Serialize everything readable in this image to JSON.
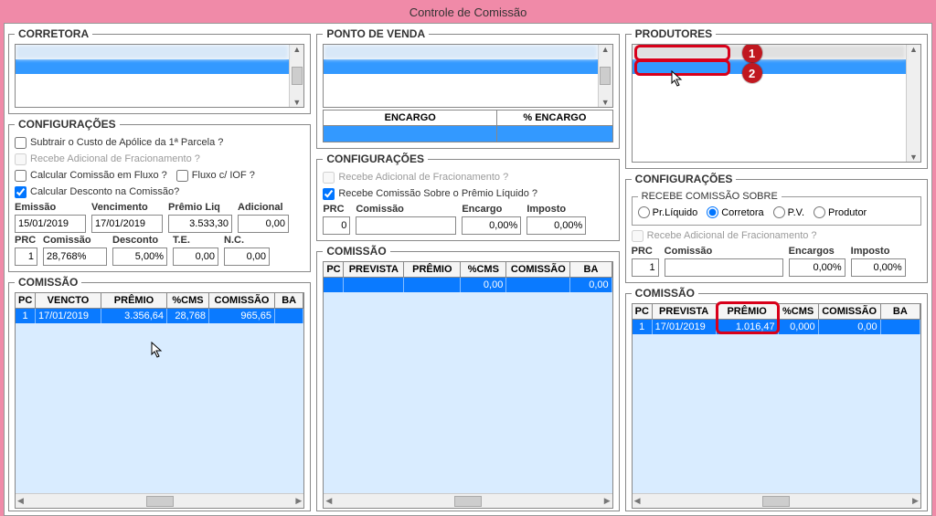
{
  "window_title": "Controle de Comissão",
  "col1": {
    "corretora_title": "CORRETORA",
    "config_title": "CONFIGURAÇÕES",
    "cb_subtrair": "Subtrair o Custo de Apólice da 1ª Parcela ?",
    "cb_recebe_adic": "Recebe Adicional de Fracionamento ?",
    "cb_calc_fluxo": "Calcular Comissão em Fluxo ?",
    "cb_fluxo_iof": "Fluxo c/ IOF ?",
    "cb_calc_desc": "Calcular Desconto na Comissão?",
    "lbl_emissao": "Emissão",
    "lbl_venc": "Vencimento",
    "lbl_premio_liq": "Prêmio Liq",
    "lbl_adicional": "Adicional",
    "val_emissao": "15/01/2019",
    "val_venc": "17/01/2019",
    "val_premio_liq": "3.533,30",
    "val_adicional": "0,00",
    "lbl_prc": "PRC",
    "lbl_comissao": "Comissão",
    "lbl_desconto": "Desconto",
    "lbl_te": "T.E.",
    "lbl_nc": "N.C.",
    "val_prc": "1",
    "val_comissao": "28,768%",
    "val_desconto": "5,00%",
    "val_te": "0,00",
    "val_nc": "0,00",
    "comissao_title": "COMISSÃO",
    "grid": {
      "headers": [
        "PC",
        "VENCTO",
        "PRÊMIO",
        "%CMS",
        "COMISSÃO",
        "BA"
      ],
      "row": [
        "1",
        "17/01/2019",
        "3.356,64",
        "28,768",
        "965,65",
        ""
      ]
    }
  },
  "col2": {
    "pdv_title": "PONTO DE VENDA",
    "lbl_encargo": "ENCARGO",
    "lbl_pct_encargo": "% ENCARGO",
    "config_title": "CONFIGURAÇÕES",
    "cb_recebe_adic": "Recebe Adicional de Fracionamento ?",
    "cb_recebe_com_liq": "Recebe Comissão Sobre o Prêmio Líquido ?",
    "lbl_prc": "PRC",
    "lbl_comissao": "Comissão",
    "lbl_encargo2": "Encargo",
    "lbl_imposto": "Imposto",
    "val_prc": "0",
    "val_comissao": "",
    "val_encargo": "0,00%",
    "val_imposto": "0,00%",
    "comissao_title": "COMISSÃO",
    "grid": {
      "headers": [
        "PC",
        "PREVISTA",
        "PRÊMIO",
        "%CMS",
        "COMISSÃO",
        "BA"
      ],
      "row": [
        "",
        "",
        "",
        "0,00",
        "",
        "0,00"
      ]
    }
  },
  "col3": {
    "prod_title": "PRODUTORES",
    "config_title": "CONFIGURAÇÕES",
    "recebe_sobre_title": "RECEBE COMISSÃO SOBRE",
    "radios": {
      "r1": "Pr.Líquido",
      "r2": "Corretora",
      "r3": "P.V.",
      "r4": "Produtor"
    },
    "cb_recebe_adic": "Recebe Adicional de Fracionamento ?",
    "lbl_prc": "PRC",
    "lbl_comissao": "Comissão",
    "lbl_encargos": "Encargos",
    "lbl_imposto": "Imposto",
    "val_prc": "1",
    "val_comissao": "",
    "val_encargos": "0,00%",
    "val_imposto": "0,00%",
    "comissao_title": "COMISSÃO",
    "grid": {
      "headers": [
        "PC",
        "PREVISTA",
        "PRÊMIO",
        "%CMS",
        "COMISSÃO",
        "BA"
      ],
      "row": [
        "1",
        "17/01/2019",
        "1.016,47",
        "0,000",
        "0,00",
        ""
      ]
    }
  },
  "badges": {
    "b1": "1",
    "b2": "2"
  }
}
